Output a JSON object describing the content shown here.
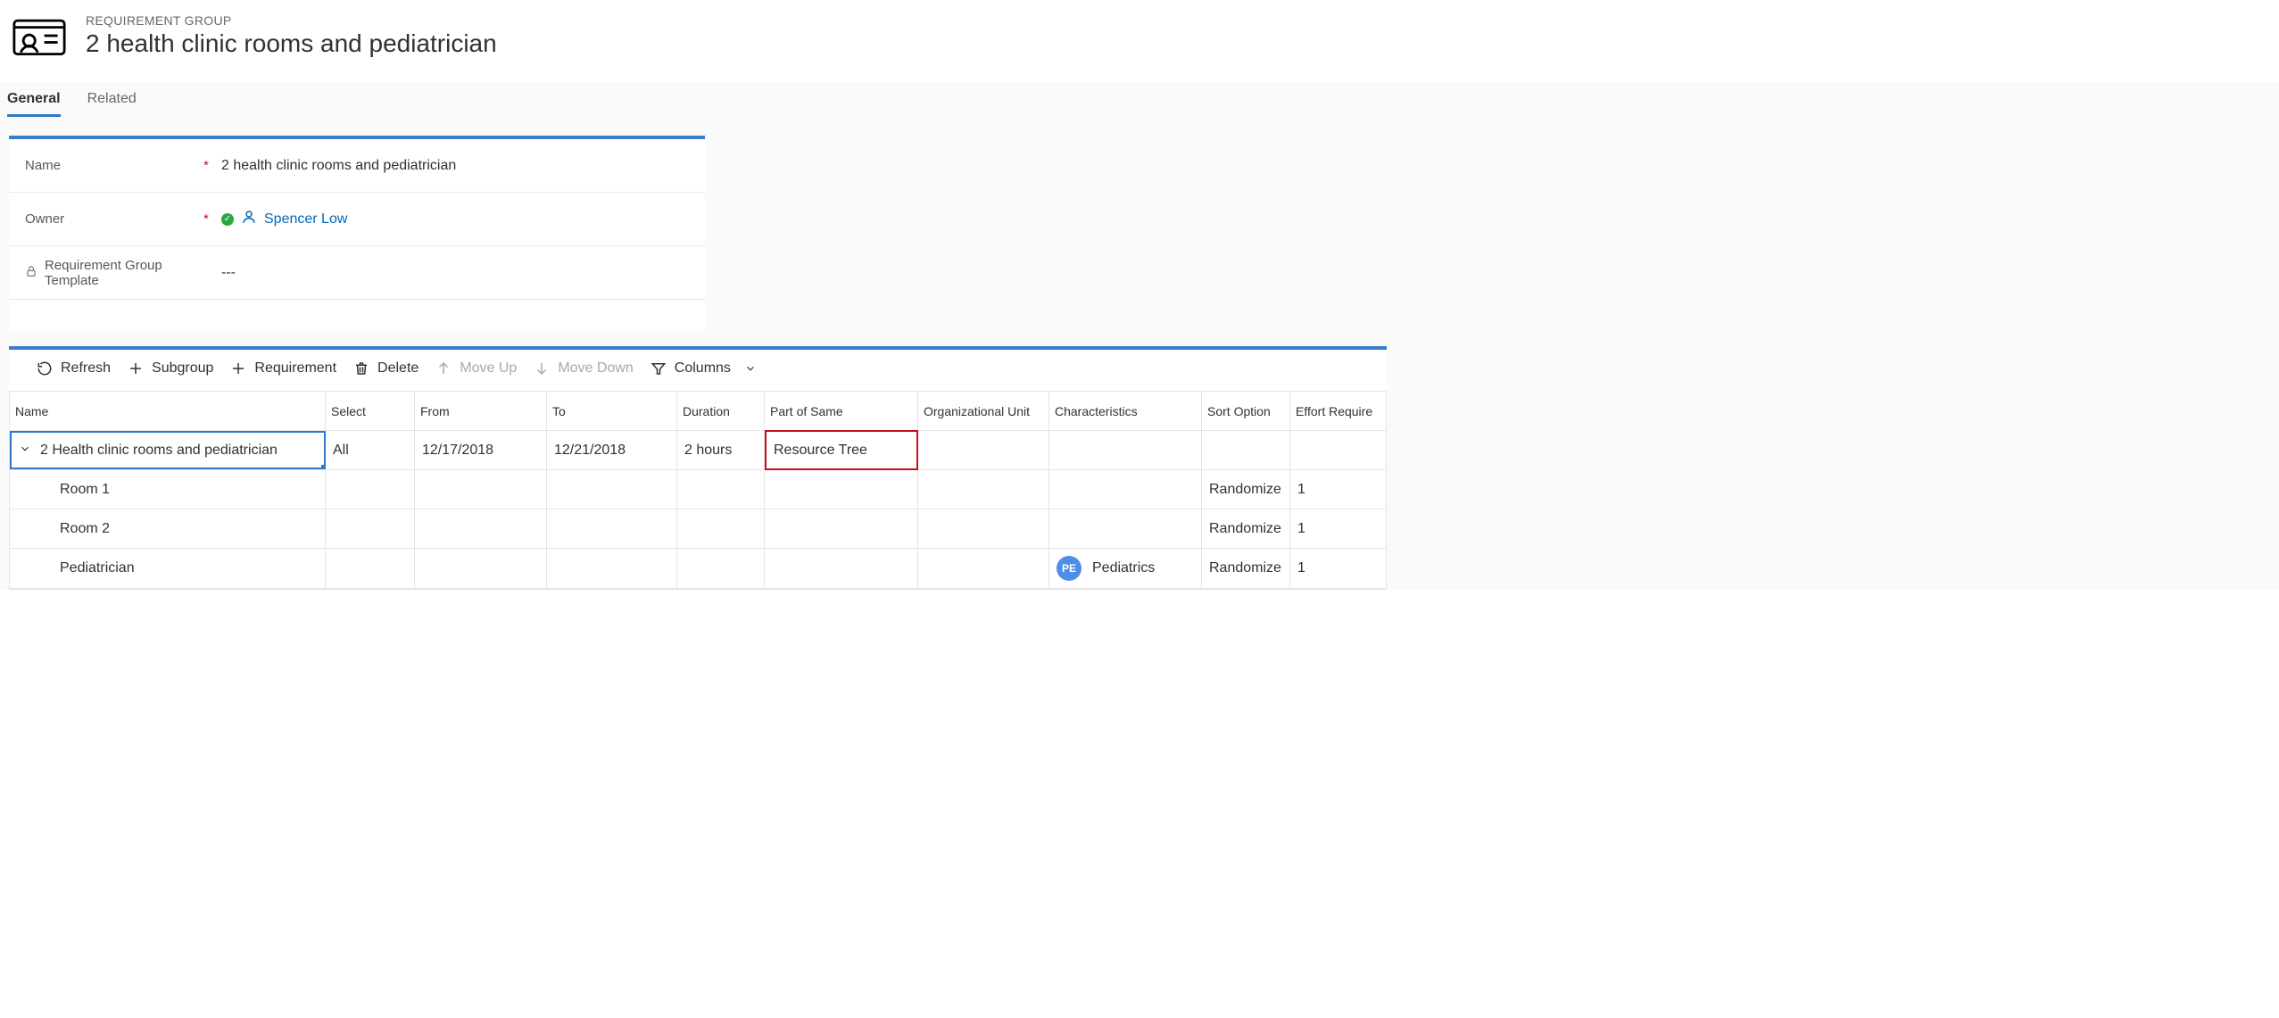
{
  "header": {
    "eyebrow": "REQUIREMENT GROUP",
    "title": "2 health clinic rooms and pediatrician"
  },
  "tabs": {
    "general": "General",
    "related": "Related"
  },
  "general_fields": {
    "name_label": "Name",
    "name_value": "2 health clinic rooms and pediatrician",
    "owner_label": "Owner",
    "owner_value": "Spencer Low",
    "template_label": "Requirement Group Template",
    "template_value": "---"
  },
  "toolbar": {
    "refresh": "Refresh",
    "subgroup": "Subgroup",
    "requirement": "Requirement",
    "delete": "Delete",
    "moveup": "Move Up",
    "movedown": "Move Down",
    "columns": "Columns"
  },
  "grid": {
    "headers": {
      "name": "Name",
      "select": "Select",
      "from": "From",
      "to": "To",
      "duration": "Duration",
      "part": "Part of Same",
      "org": "Organizational Unit",
      "char": "Characteristics",
      "sort": "Sort Option",
      "effort": "Effort Require"
    },
    "rows": [
      {
        "name": "2 Health clinic rooms and pediatrician",
        "select": "All",
        "from": "12/17/2018",
        "to": "12/21/2018",
        "duration": "2 hours",
        "part": "Resource Tree",
        "org": "",
        "char": "",
        "char_badge": "",
        "sort": "",
        "effort": ""
      },
      {
        "name": "Room 1",
        "select": "",
        "from": "",
        "to": "",
        "duration": "",
        "part": "",
        "org": "",
        "char": "",
        "char_badge": "",
        "sort": "Randomize",
        "effort": "1"
      },
      {
        "name": "Room 2",
        "select": "",
        "from": "",
        "to": "",
        "duration": "",
        "part": "",
        "org": "",
        "char": "",
        "char_badge": "",
        "sort": "Randomize",
        "effort": "1"
      },
      {
        "name": "Pediatrician",
        "select": "",
        "from": "",
        "to": "",
        "duration": "",
        "part": "",
        "org": "",
        "char": "Pediatrics",
        "char_badge": "PE",
        "sort": "Randomize",
        "effort": "1"
      }
    ]
  }
}
